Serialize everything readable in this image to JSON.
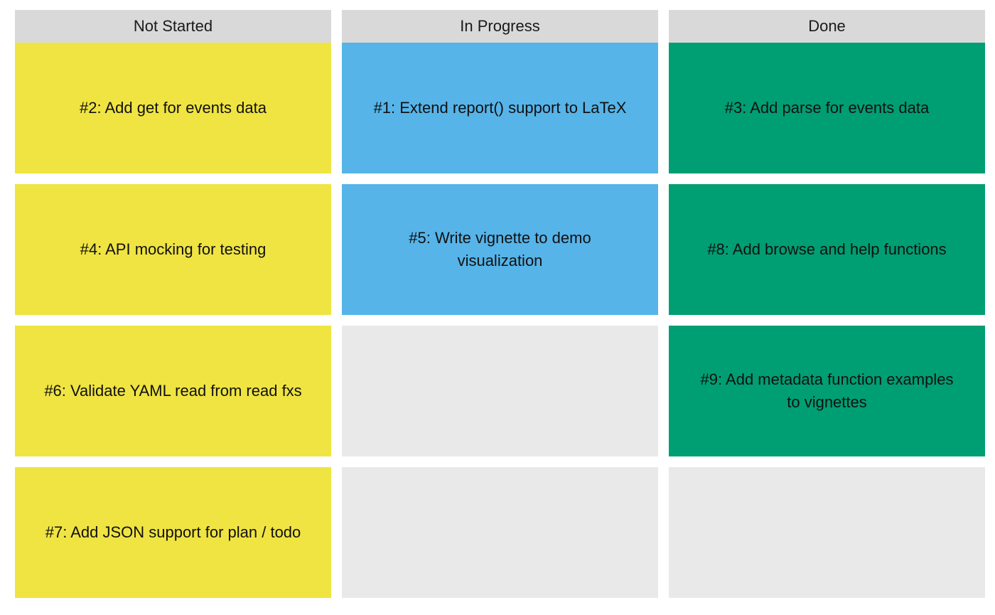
{
  "colors": {
    "header_bg": "#d9d9d9",
    "not_started": "#f0e442",
    "in_progress": "#56b4e9",
    "done": "#009e73",
    "empty_slot": "#e9e9e9"
  },
  "board": {
    "columns": [
      {
        "title": "Not Started",
        "cards": [
          "#2: Add get for events data",
          "#4: API mocking for testing",
          "#6: Validate YAML read from read fxs",
          "#7: Add JSON support for plan / todo"
        ]
      },
      {
        "title": "In Progress",
        "cards": [
          "#1: Extend report() support to LaTeX",
          "#5: Write vignette to demo visualization"
        ]
      },
      {
        "title": "Done",
        "cards": [
          "#3: Add parse for events data",
          "#8: Add browse and help functions",
          "#9: Add metadata function examples to vignettes"
        ]
      }
    ]
  }
}
